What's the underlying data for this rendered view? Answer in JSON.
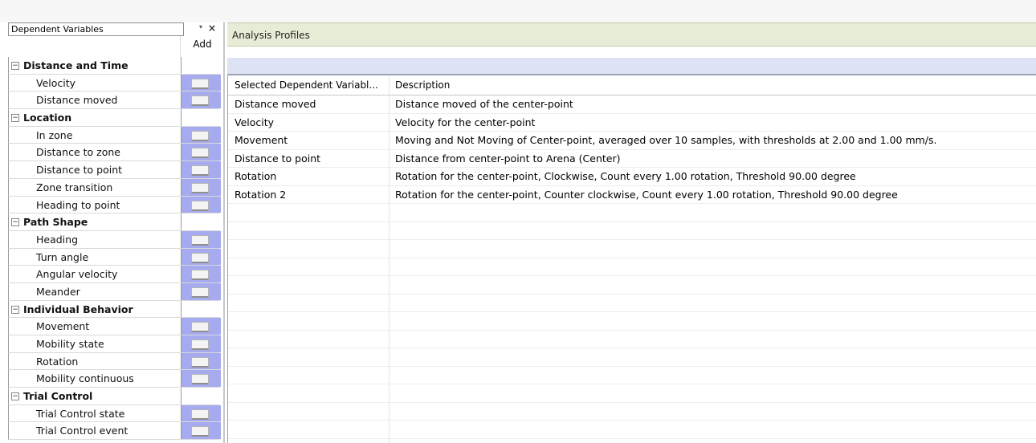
{
  "left_panel": {
    "title": "Dependent Variables",
    "caret": "▾",
    "close": "×",
    "add_header": "Add",
    "groups": [
      {
        "name": "Distance and Time",
        "items": [
          "Velocity",
          "Distance moved"
        ]
      },
      {
        "name": "Location",
        "items": [
          "In zone",
          "Distance to zone",
          "Distance to point",
          "Zone transition",
          "Heading to point"
        ]
      },
      {
        "name": "Path Shape",
        "items": [
          "Heading",
          "Turn angle",
          "Angular velocity",
          "Meander"
        ]
      },
      {
        "name": "Individual Behavior",
        "items": [
          "Movement",
          "Mobility state",
          "Rotation",
          "Mobility continuous"
        ]
      },
      {
        "name": "Trial Control",
        "items": [
          "Trial Control state",
          "Trial Control event"
        ]
      }
    ],
    "toggle_glyph": "−",
    "add_cell_color": "#a6aaee"
  },
  "right_panel": {
    "title": "Analysis Profiles",
    "columns": [
      "Selected Dependent Variabl...",
      "Description"
    ],
    "rows": [
      {
        "name": "Distance moved",
        "description": "Distance moved of the center-point"
      },
      {
        "name": "Velocity",
        "description": "Velocity for the center-point"
      },
      {
        "name": "Movement",
        "description": "Moving and Not Moving of Center-point, averaged over 10 samples, with thresholds at 2.00 and 1.00 mm/s."
      },
      {
        "name": "Distance to point",
        "description": "Distance from center-point to Arena (Center)"
      },
      {
        "name": "Rotation",
        "description": "Rotation for the center-point, Clockwise, Count every 1.00 rotation, Threshold 90.00 degree"
      },
      {
        "name": "Rotation 2",
        "description": "Rotation for the center-point, Counter clockwise, Count every 1.00 rotation, Threshold 90.00 degree"
      }
    ],
    "empty_rows": 13,
    "header_color": "#e7ecd6",
    "band_color": "#dde3f5"
  }
}
